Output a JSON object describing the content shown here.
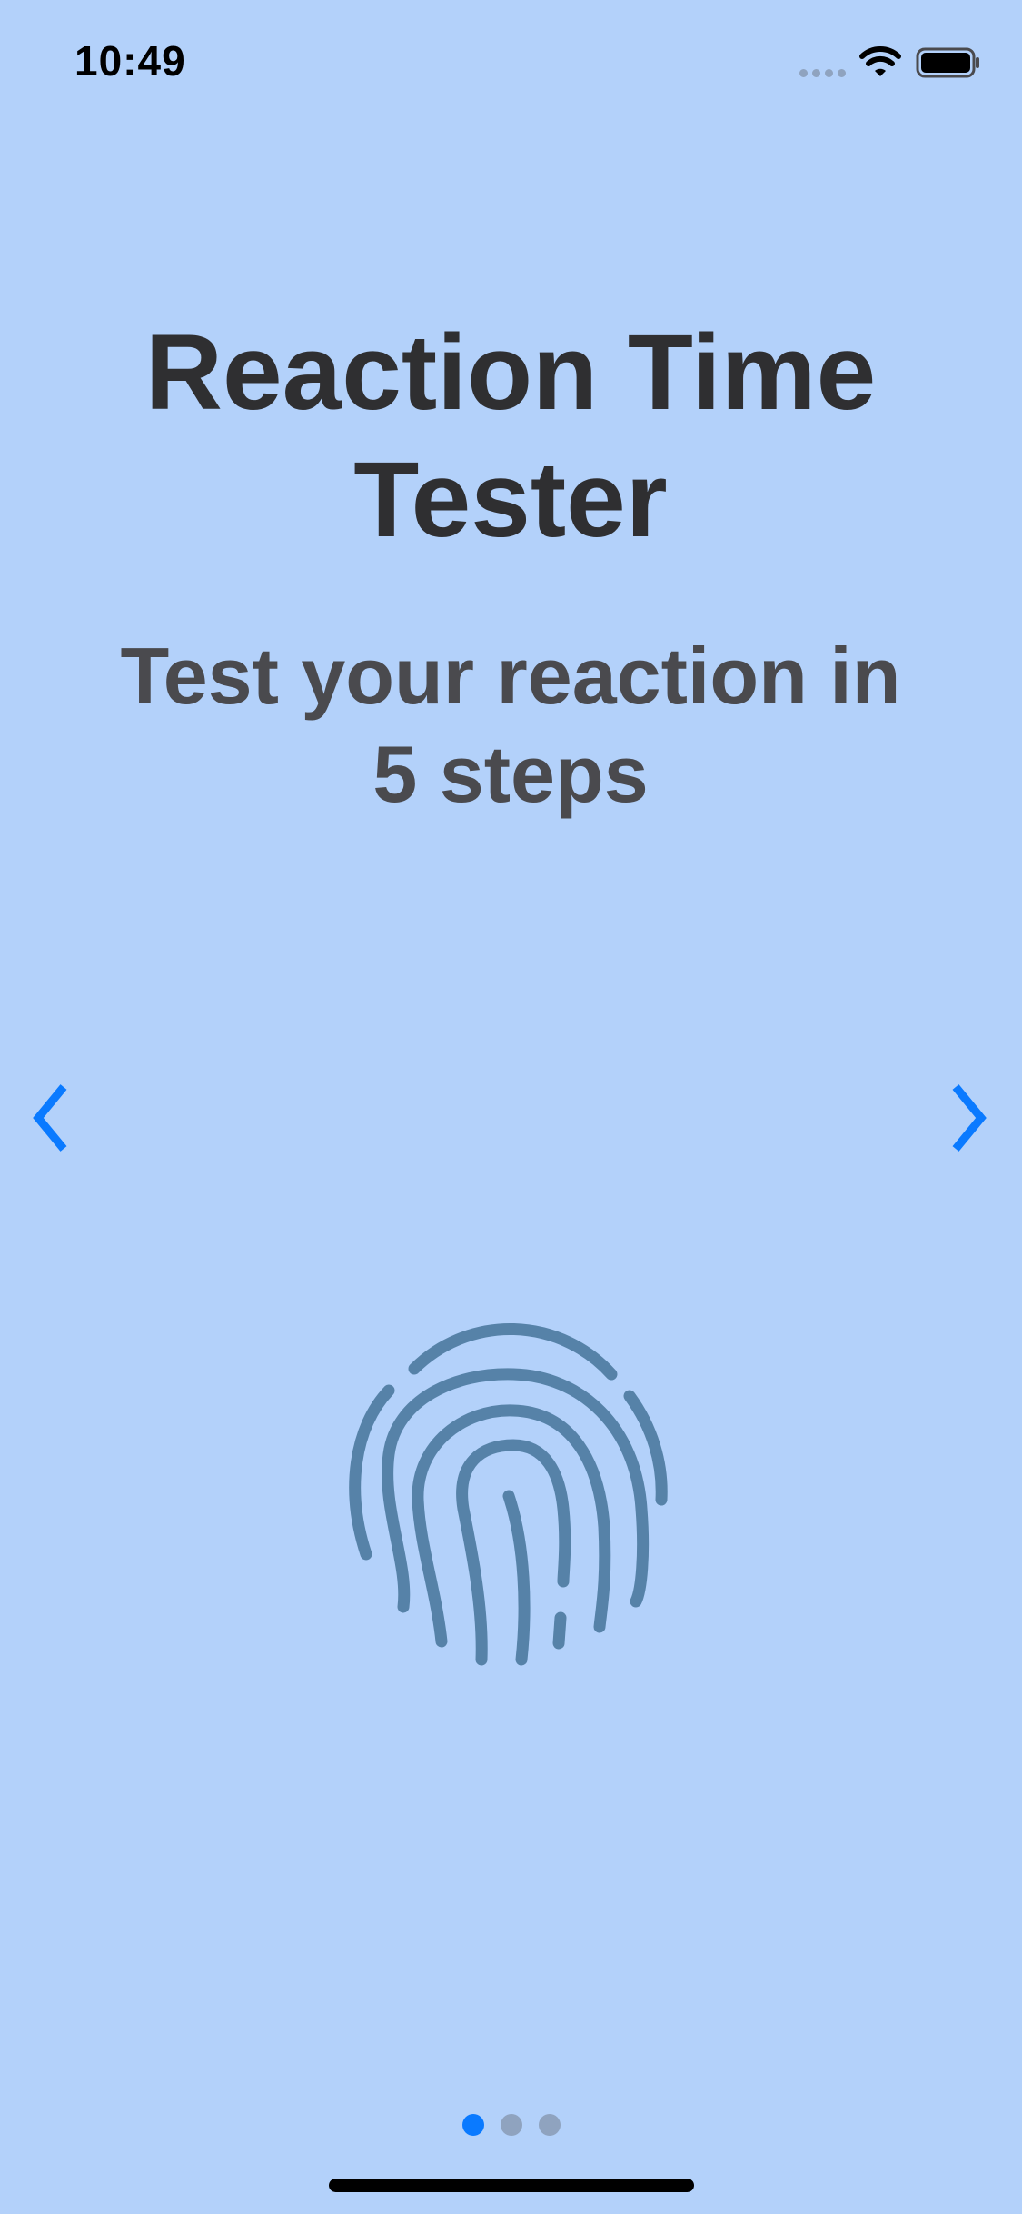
{
  "status_bar": {
    "time": "10:49"
  },
  "onboarding": {
    "title": "Reaction Time Tester",
    "subtitle": "Test your reaction in 5 steps",
    "illustration_icon": "fingerprint-icon",
    "prev_icon": "chevron-left-icon",
    "next_icon": "chevron-right-icon"
  },
  "pagination": {
    "total_pages": 3,
    "current_page": 1
  },
  "colors": {
    "background": "#b3d1fa",
    "accent": "#0a7aff",
    "title_text": "#2f2f31",
    "subtitle_text": "#4a4a4e",
    "fingerprint": "#5682a8",
    "page_dot_inactive": "#8fa3bf"
  }
}
